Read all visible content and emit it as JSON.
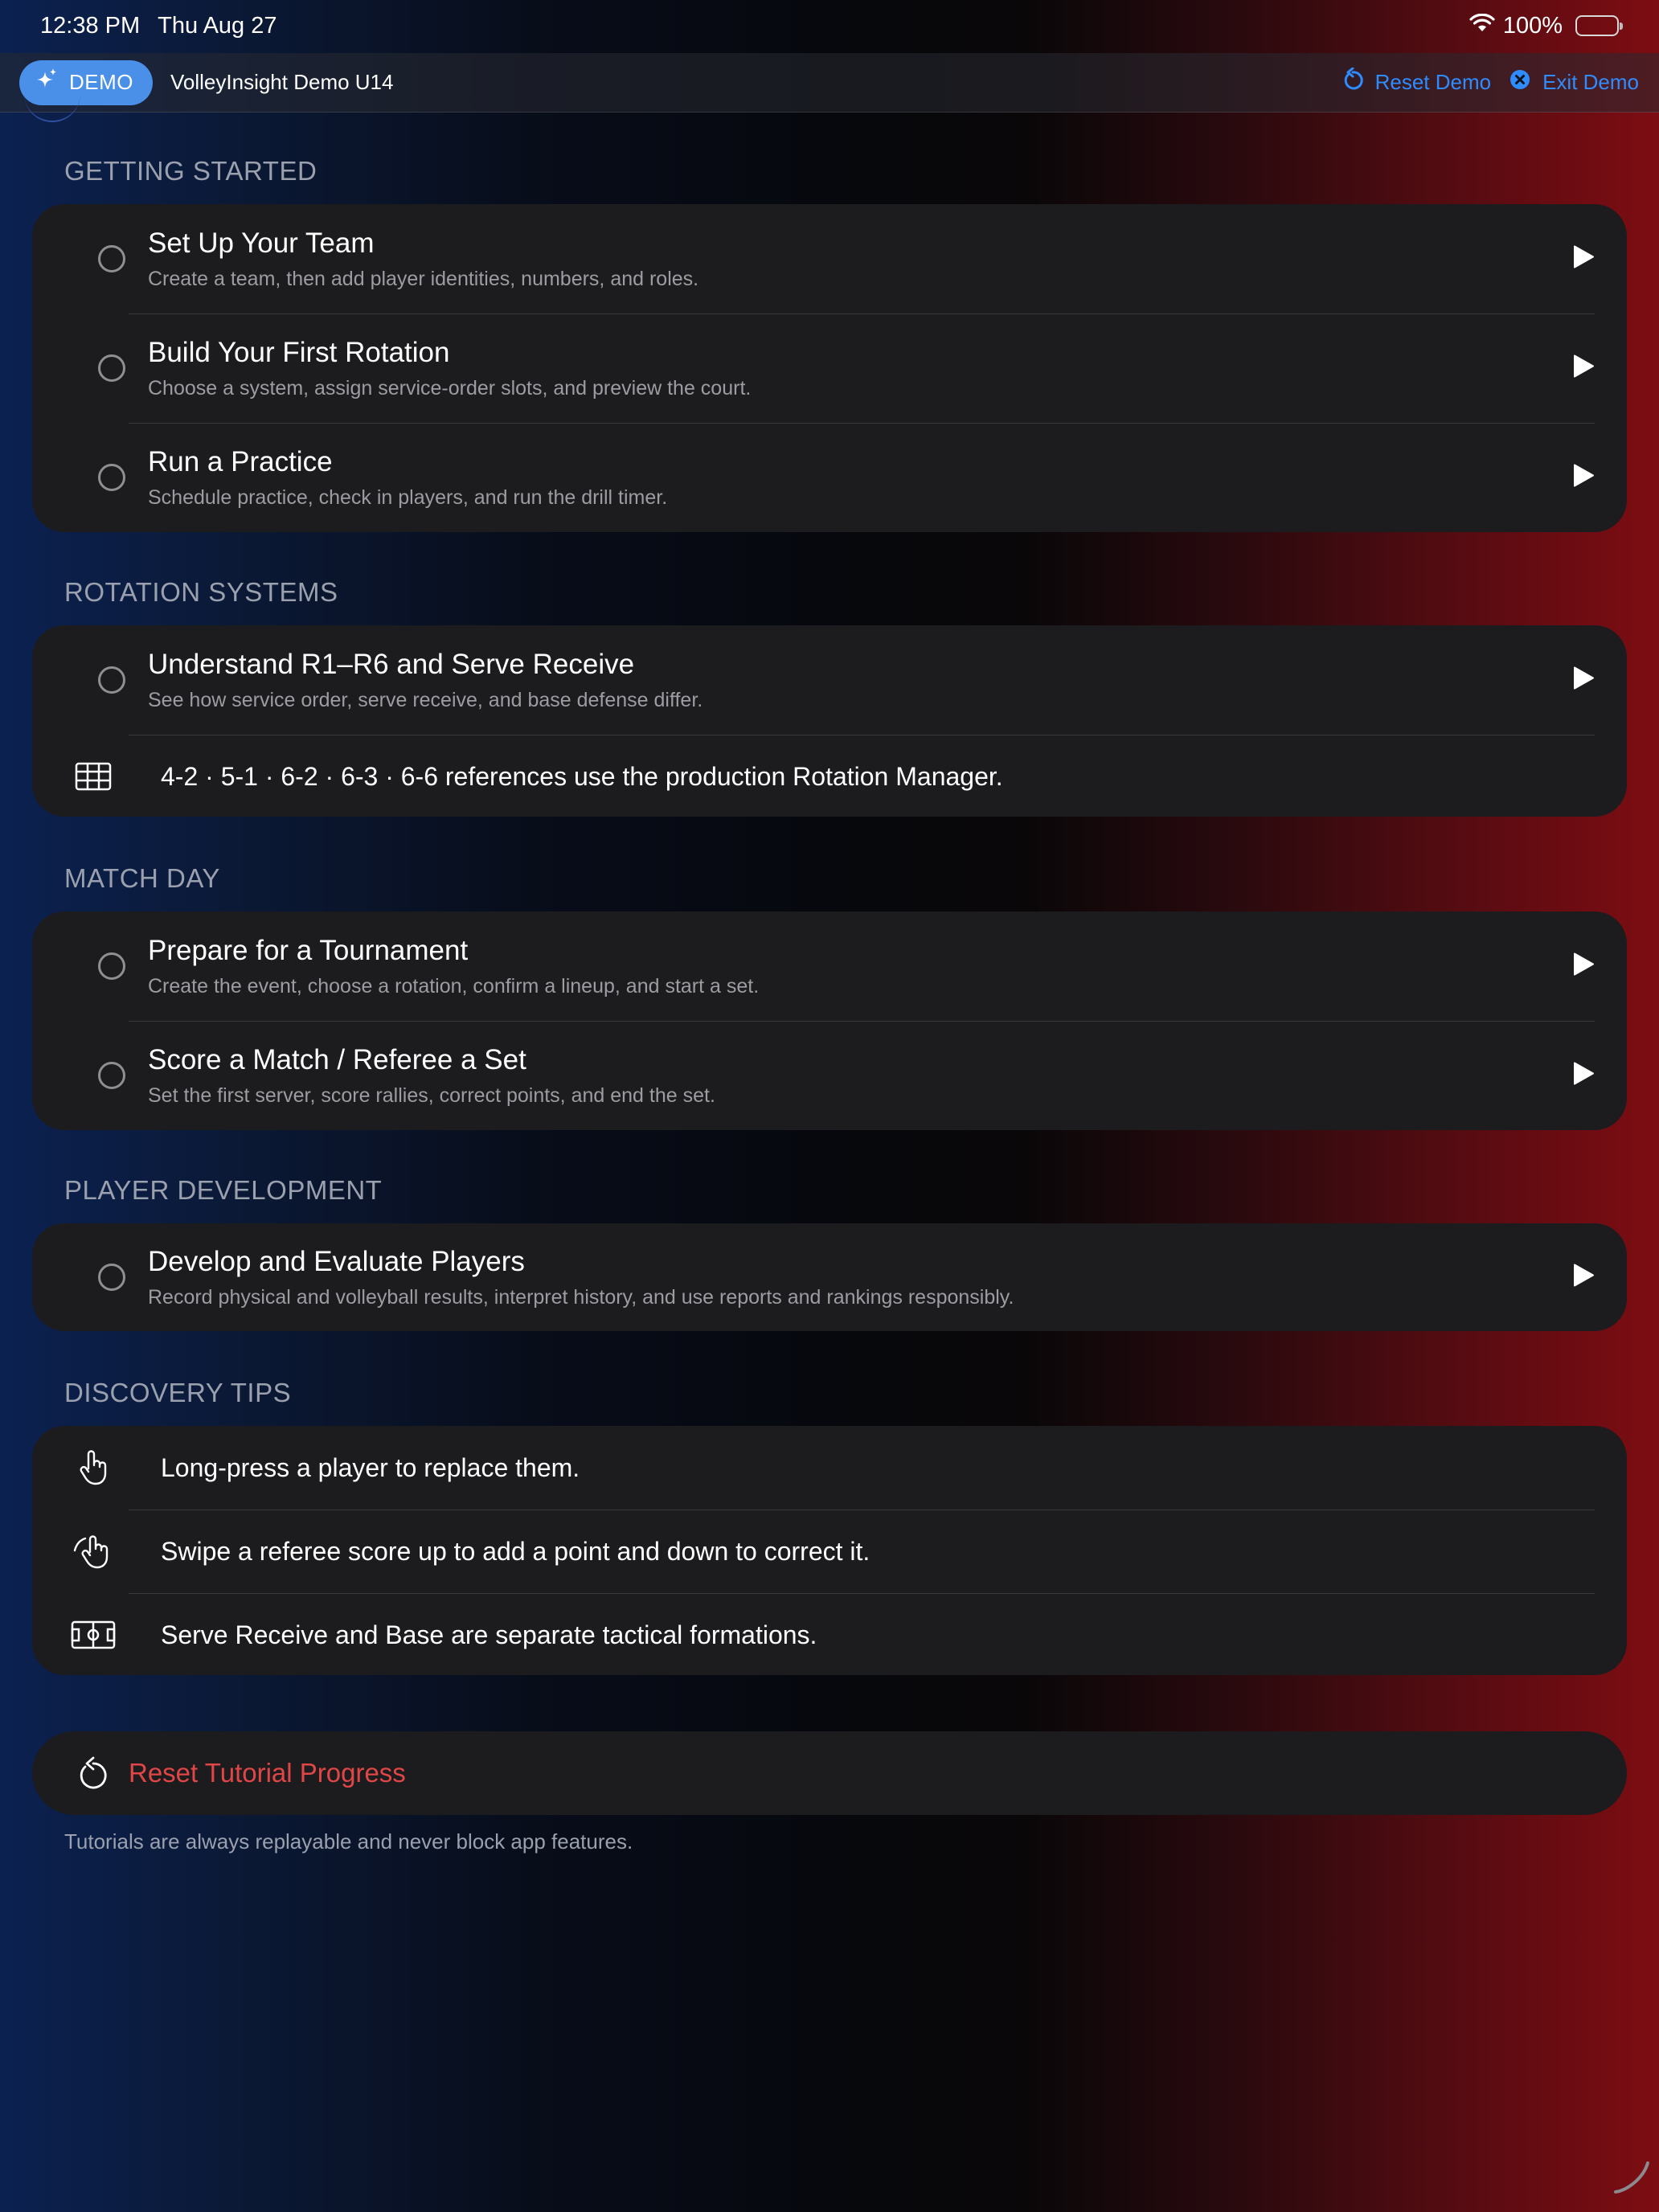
{
  "status_bar": {
    "time": "12:38 PM",
    "date": "Thu Aug 27",
    "battery": "100%"
  },
  "demo_bar": {
    "badge": "DEMO",
    "title": "VolleyInsight Demo U14",
    "reset_label": "Reset Demo",
    "exit_label": "Exit Demo",
    "accent": "#2f8cff",
    "badge_color": "#4a8fe8"
  },
  "sections": {
    "getting_started": {
      "header": "GETTING STARTED",
      "items": [
        {
          "title": "Set Up Your Team",
          "subtitle": "Create a team, then add player identities, numbers, and roles."
        },
        {
          "title": "Build Your First Rotation",
          "subtitle": "Choose a system, assign service-order slots, and preview the court."
        },
        {
          "title": "Run a Practice",
          "subtitle": "Schedule practice, check in players, and run the drill timer."
        }
      ]
    },
    "rotation_systems": {
      "header": "ROTATION SYSTEMS",
      "items": [
        {
          "title": "Understand R1–R6 and Serve Receive",
          "subtitle": "See how service order, serve receive, and base defense differ."
        }
      ],
      "info": "4-2 · 5-1 · 6-2 · 6-3 · 6-6 references use the production Rotation Manager."
    },
    "match_day": {
      "header": "MATCH DAY",
      "items": [
        {
          "title": "Prepare for a Tournament",
          "subtitle": "Create the event, choose a rotation, confirm a lineup, and start a set."
        },
        {
          "title": "Score a Match / Referee a Set",
          "subtitle": "Set the first server, score rallies, correct points, and end the set."
        }
      ]
    },
    "player_development": {
      "header": "PLAYER DEVELOPMENT",
      "items": [
        {
          "title": "Develop and Evaluate Players",
          "subtitle": "Record physical and volleyball results, interpret history, and use reports and rankings responsibly."
        }
      ]
    },
    "discovery_tips": {
      "header": "DISCOVERY TIPS",
      "tips": [
        {
          "icon": "hand-point-icon",
          "text": "Long-press a player to replace them."
        },
        {
          "icon": "hand-swipe-icon",
          "text": "Swipe a referee score up to add a point and down to correct it."
        },
        {
          "icon": "court-icon",
          "text": "Serve Receive and Base are separate tactical formations."
        }
      ]
    }
  },
  "reset": {
    "label": "Reset Tutorial Progress",
    "color": "#e04646"
  },
  "footnote": "Tutorials are always replayable and never block app features."
}
